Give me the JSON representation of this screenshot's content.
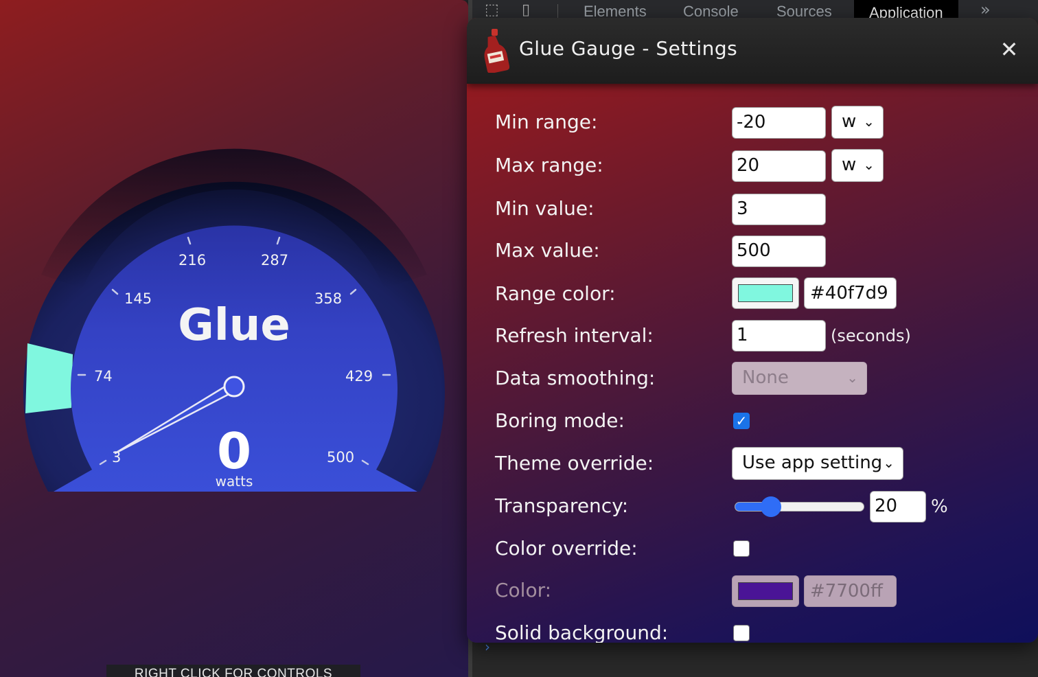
{
  "gauge": {
    "title": "Glue",
    "value": "0",
    "unit": "watts",
    "min_value": 3,
    "max_value": 500,
    "ticks": [
      "3",
      "74",
      "145",
      "216",
      "287",
      "358",
      "429",
      "500"
    ],
    "range_color": "#40f7d9",
    "footer": "RIGHT CLICK FOR CONTROLS"
  },
  "devtools": {
    "tabs": [
      "Elements",
      "Console",
      "Sources",
      "Application"
    ],
    "active_tab": "Application",
    "more": "»",
    "prompt": "›"
  },
  "settings": {
    "title": "Glue Gauge - Settings",
    "close": "✕",
    "min_range": {
      "label": "Min range:",
      "value": "-20",
      "unit": "w"
    },
    "max_range": {
      "label": "Max range:",
      "value": "20",
      "unit": "w"
    },
    "min_value": {
      "label": "Min value:",
      "value": "3"
    },
    "max_value": {
      "label": "Max value:",
      "value": "500"
    },
    "range_color": {
      "label": "Range color:",
      "hex": "#40f7d9",
      "color": "#80f7df"
    },
    "refresh_interval": {
      "label": "Refresh interval:",
      "value": "1",
      "unit": "(seconds)"
    },
    "data_smoothing": {
      "label": "Data smoothing:",
      "value": "None"
    },
    "boring_mode": {
      "label": "Boring mode:",
      "checked": true
    },
    "theme_override": {
      "label": "Theme override:",
      "value": "Use app setting"
    },
    "transparency": {
      "label": "Transparency:",
      "value": "20",
      "unit": "%",
      "level": 0.2
    },
    "color_override": {
      "label": "Color override:",
      "checked": false
    },
    "color": {
      "label": "Color:",
      "hex": "#7700ff",
      "color": "#4a1496"
    },
    "solid_background": {
      "label": "Solid background:",
      "checked": false
    }
  }
}
